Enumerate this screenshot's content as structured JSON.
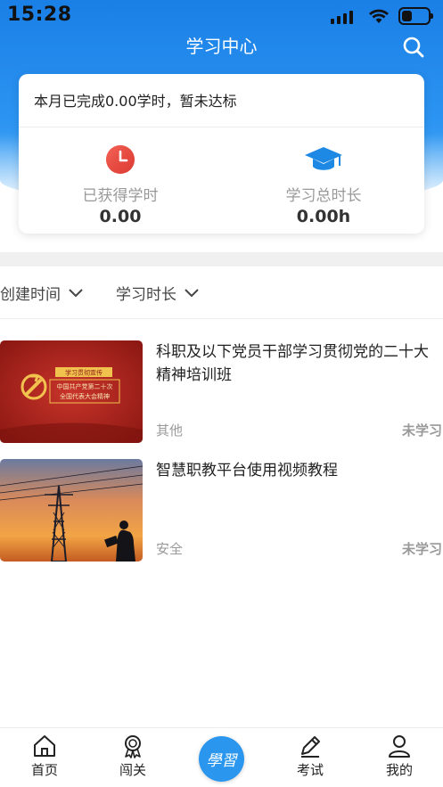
{
  "status_bar": {
    "time": "15:28"
  },
  "nav": {
    "title": "学习中心"
  },
  "summary": {
    "message": "本月已完成0.00学时，暂未达标",
    "earned_label": "已获得学时",
    "earned_value": "0.00",
    "total_label": "学习总时长",
    "total_value": "0.00h"
  },
  "filters": [
    {
      "label": "创建时间"
    },
    {
      "label": "学习时长"
    }
  ],
  "courses": [
    {
      "title": "科职及以下党员干部学习贯彻党的二十大精神培训班",
      "tag": "其他",
      "status": "未学习",
      "thumb_banner_top": "学习贯彻宣传",
      "thumb_banner_line1": "中国共产党第二十次",
      "thumb_banner_line2": "全国代表大会精神"
    },
    {
      "title": "智慧职教平台使用视频教程",
      "tag": "安全",
      "status": "未学习"
    }
  ],
  "tabbar": {
    "home": "首页",
    "challenge": "闯关",
    "center": "學習",
    "exam": "考试",
    "mine": "我的"
  },
  "colors": {
    "primary": "#2a96ee",
    "header_top": "#1a7fe6",
    "clock_red": "#e8453c",
    "cap_blue": "#1e88e5",
    "muted_text": "#999999"
  },
  "icons": [
    "search-icon",
    "clock-icon",
    "graduation-cap-icon",
    "chevron-down-icon",
    "home-icon",
    "medal-icon",
    "pencil-icon",
    "user-icon"
  ]
}
